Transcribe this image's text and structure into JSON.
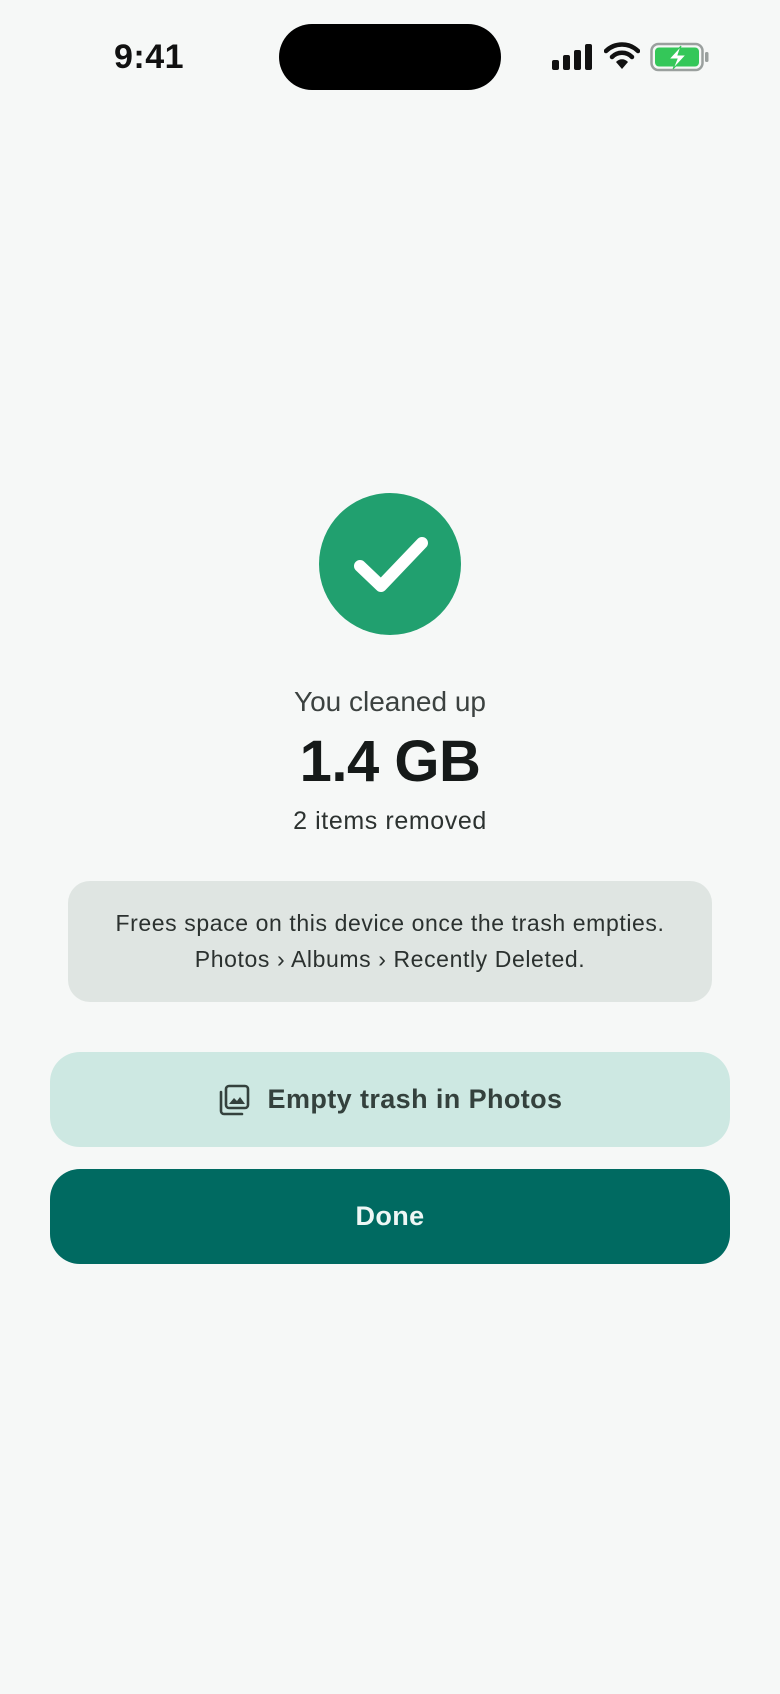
{
  "status_bar": {
    "time": "9:41",
    "icons": [
      "signal-icon",
      "wifi-icon",
      "battery-charging-icon"
    ],
    "battery_color": "#34c759"
  },
  "result": {
    "badge_icon": "checkmark-icon",
    "badge_color": "#21a06f",
    "subtitle": "You cleaned up",
    "amount": "1.4 GB",
    "items_removed": "2 items removed"
  },
  "info": {
    "line1": "Frees space on this device once the trash empties.",
    "line2": "Photos › Albums › Recently Deleted."
  },
  "actions": {
    "empty_trash": {
      "label": "Empty trash in Photos",
      "icon": "photo-library-icon"
    },
    "done": {
      "label": "Done"
    }
  },
  "colors": {
    "background": "#f6f8f7",
    "primary": "#006a61",
    "secondary": "#cde8e2",
    "card": "#dfe5e2"
  }
}
